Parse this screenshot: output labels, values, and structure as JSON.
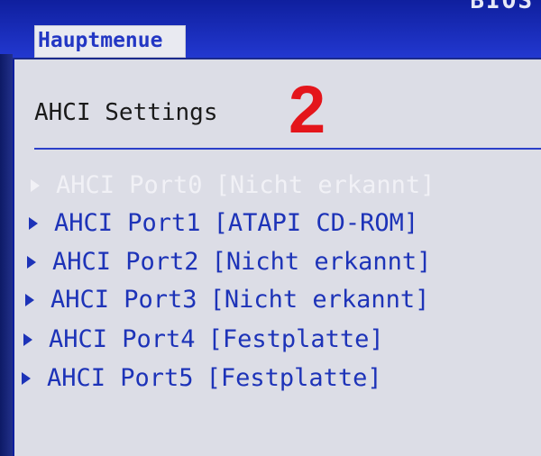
{
  "header": {
    "bios_label": "BIOS",
    "tab_label": "Hauptmenue"
  },
  "page": {
    "title": "AHCI Settings",
    "step_number": "2"
  },
  "colors": {
    "header_blue": "#1f36c8",
    "item_text": "#1d33b8",
    "dimmed_item_text": "#f1f1f6",
    "step_red": "#e4151b"
  },
  "icons": {
    "submenu": "triangle-right-icon"
  },
  "ports": [
    {
      "name": "AHCI Port0",
      "value": "[Nicht erkannt]",
      "state": "dimmed"
    },
    {
      "name": "AHCI Port1",
      "value": "[ATAPI CD-ROM]",
      "state": "normal"
    },
    {
      "name": "AHCI Port2",
      "value": "[Nicht erkannt]",
      "state": "normal"
    },
    {
      "name": "AHCI Port3",
      "value": "[Nicht erkannt]",
      "state": "normal"
    },
    {
      "name": "AHCI Port4",
      "value": "[Festplatte]",
      "state": "normal"
    },
    {
      "name": "AHCI Port5",
      "value": "[Festplatte]",
      "state": "normal"
    }
  ]
}
